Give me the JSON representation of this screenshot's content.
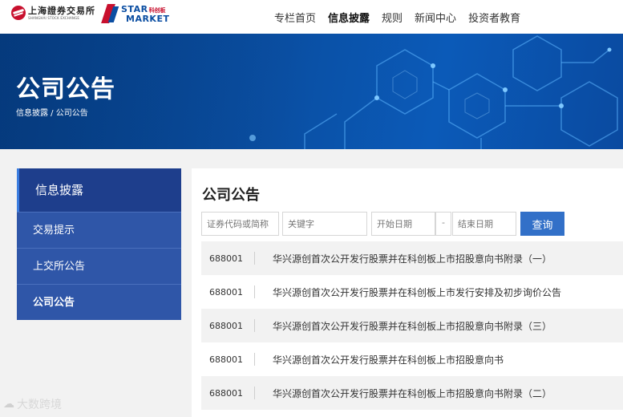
{
  "header": {
    "sse_logo": {
      "cn": "上海證券交易所",
      "en": "SHANGHAI STOCK EXCHANGE"
    },
    "star_logo": {
      "en_top": "STAR",
      "cn": "科创板",
      "en_bottom": "MARKET"
    },
    "nav": [
      {
        "label": "专栏首页",
        "active": false
      },
      {
        "label": "信息披露",
        "active": true
      },
      {
        "label": "规则",
        "active": false
      },
      {
        "label": "新闻中心",
        "active": false
      },
      {
        "label": "投资者教育",
        "active": false
      }
    ]
  },
  "banner": {
    "title": "公司公告",
    "breadcrumb": "信息披露 / 公司公告"
  },
  "sidebar": {
    "heading": "信息披露",
    "items": [
      {
        "label": "交易提示",
        "active": false
      },
      {
        "label": "上交所公告",
        "active": false
      },
      {
        "label": "公司公告",
        "active": true
      }
    ]
  },
  "main": {
    "title": "公司公告",
    "filters": {
      "code_placeholder": "证券代码或简称",
      "keyword_placeholder": "关键字",
      "start_placeholder": "开始日期",
      "dash": "-",
      "end_placeholder": "结束日期",
      "search_label": "查询"
    },
    "rows": [
      {
        "code": "688001",
        "title": "华兴源创首次公开发行股票并在科创板上市招股意向书附录（一）"
      },
      {
        "code": "688001",
        "title": "华兴源创首次公开发行股票并在科创板上市发行安排及初步询价公告"
      },
      {
        "code": "688001",
        "title": "华兴源创首次公开发行股票并在科创板上市招股意向书附录（三）"
      },
      {
        "code": "688001",
        "title": "华兴源创首次公开发行股票并在科创板上市招股意向书"
      },
      {
        "code": "688001",
        "title": "华兴源创首次公开发行股票并在科创板上市招股意向书附录（二）"
      }
    ]
  },
  "watermark": "大数跨境",
  "colors": {
    "brand_red": "#c8102e",
    "brand_blue": "#0b4ea2",
    "sidebar_head": "#1e3e8c",
    "sidebar_item": "#2f56a8",
    "button": "#3270c8"
  }
}
